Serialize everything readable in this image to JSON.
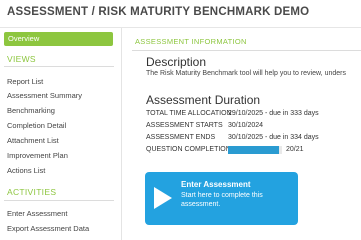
{
  "header": {
    "title": "ASSESSMENT / RISK MATURITY BENCHMARK DEMO"
  },
  "sidebar": {
    "active_item": "Overview",
    "views_heading": "VIEWS",
    "views": [
      "Report List",
      "Assessment Summary",
      "Benchmarking",
      "Completion Detail",
      "Attachment List",
      "Improvement Plan",
      "Actions List"
    ],
    "activities_heading": "ACTIVITIES",
    "activities": [
      "Enter Assessment",
      "Export Assessment Data"
    ]
  },
  "main": {
    "section_heading": "ASSESSMENT INFORMATION",
    "description": {
      "title": "Description",
      "text": "The Risk Maturity Benchmark tool will help you to review, unders"
    },
    "duration": {
      "title": "Assessment Duration",
      "rows": [
        {
          "label": "TOTAL TIME ALLOCATION",
          "value": "29/10/2025 - due in 333 days"
        },
        {
          "label": "ASSESSMENT STARTS",
          "value": "30/10/2024"
        },
        {
          "label": "ASSESSMENT ENDS",
          "value": "30/10/2025 - due in 334 days"
        }
      ],
      "completion": {
        "label": "QUESTION COMPLETION",
        "value": "20/21",
        "fraction": 0.952
      }
    },
    "enter_button": {
      "title": "Enter Assessment",
      "subtitle": "Start here to complete this assessment.",
      "icon": "play-icon"
    }
  },
  "colors": {
    "accent": "#8dc63f",
    "button": "#23a2e0",
    "progress": "#2a9bd1"
  }
}
